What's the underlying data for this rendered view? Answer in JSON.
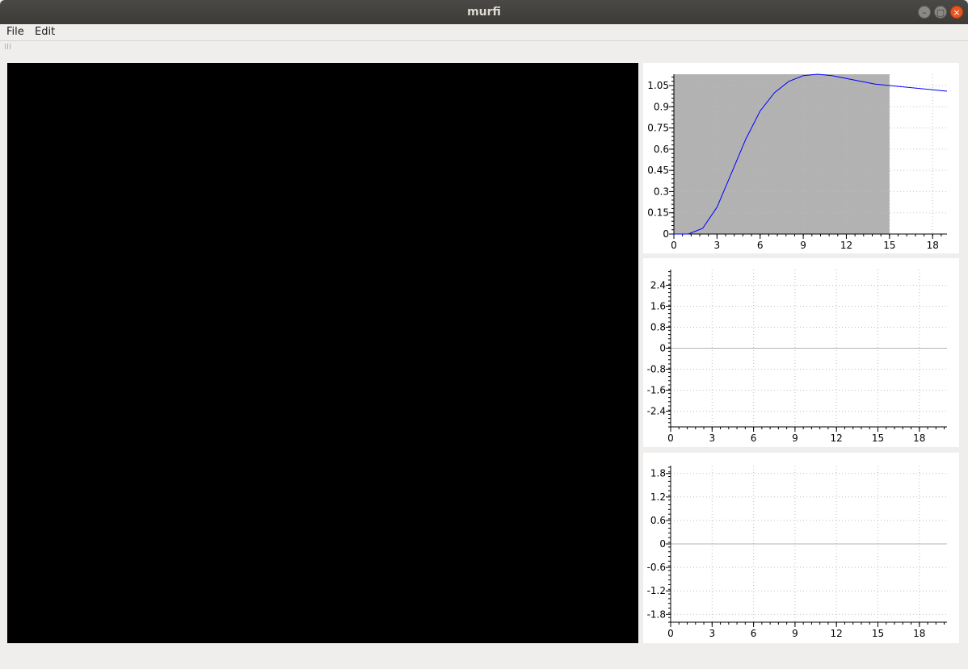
{
  "window": {
    "title": "murfi"
  },
  "menu": [
    {
      "label": "File"
    },
    {
      "label": "Edit"
    }
  ],
  "colors": {
    "curve": "#0000ff",
    "shade": "#b2b2b2",
    "grid": "#bdbdbd",
    "zero_line": "#b4b4b4"
  },
  "plots": [
    {
      "xticks": [
        "0",
        "3",
        "6",
        "9",
        "12",
        "15",
        "18"
      ],
      "yticks": [
        "0",
        "0.15",
        "0.3",
        "0.45",
        "0.6",
        "0.75",
        "0.9",
        "1.05"
      ],
      "chart_data": {
        "type": "line",
        "xlim": [
          0,
          19
        ],
        "ylim": [
          0,
          1.13
        ],
        "shaded_region": [
          0,
          15
        ],
        "series": [
          {
            "x": [
              0,
              1,
              2,
              3,
              4,
              5,
              6,
              7,
              8,
              9,
              10,
              11,
              12,
              13,
              14,
              15,
              16,
              17,
              18,
              19
            ],
            "y": [
              0,
              0,
              0.04,
              0.19,
              0.43,
              0.67,
              0.87,
              1.0,
              1.08,
              1.12,
              1.13,
              1.12,
              1.1,
              1.08,
              1.06,
              1.05,
              1.04,
              1.03,
              1.02,
              1.01
            ]
          }
        ]
      }
    },
    {
      "xticks": [
        "0",
        "3",
        "6",
        "9",
        "12",
        "15",
        "18"
      ],
      "yticks": [
        "2.4",
        "1.6",
        "0.8",
        "0",
        "-0.8",
        "-1.6",
        "-2.4"
      ],
      "chart_data": {
        "type": "line",
        "xlim": [
          0,
          20
        ],
        "ylim": [
          -3.0,
          3.0
        ],
        "series": []
      }
    },
    {
      "xticks": [
        "0",
        "3",
        "6",
        "9",
        "12",
        "15",
        "18"
      ],
      "yticks": [
        "1.8",
        "1.2",
        "0.6",
        "0",
        "-0.6",
        "-1.2",
        "-1.8"
      ],
      "chart_data": {
        "type": "line",
        "xlim": [
          0,
          20
        ],
        "ylim": [
          -2.0,
          2.0
        ],
        "series": []
      }
    }
  ]
}
